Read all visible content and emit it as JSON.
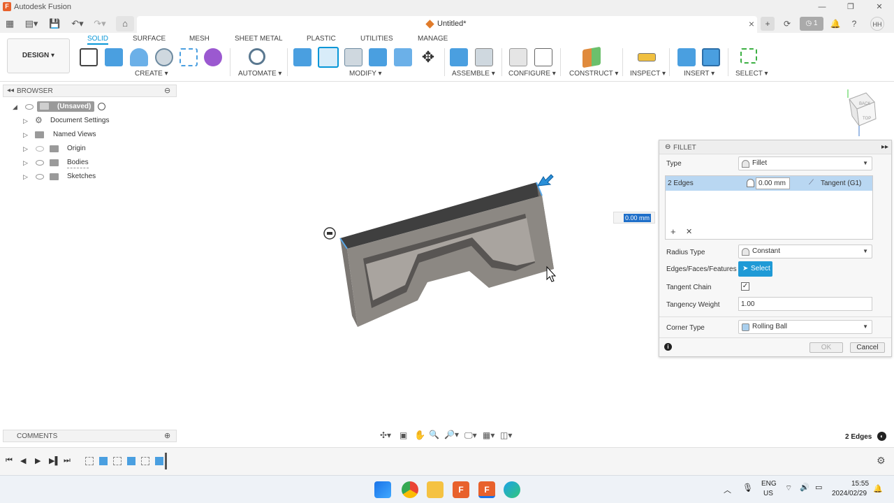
{
  "window": {
    "title": "Autodesk Fusion"
  },
  "document": {
    "title": "Untitled*"
  },
  "ribbon": {
    "tabs": [
      "SOLID",
      "SURFACE",
      "MESH",
      "SHEET METAL",
      "PLASTIC",
      "UTILITIES",
      "MANAGE"
    ],
    "design_label": "DESIGN ▾",
    "groups": [
      "CREATE ▾",
      "AUTOMATE ▾",
      "MODIFY ▾",
      "ASSEMBLE ▾",
      "CONFIGURE ▾",
      "CONSTRUCT ▾",
      "INSPECT ▾",
      "INSERT ▾",
      "SELECT ▾"
    ]
  },
  "browser": {
    "title": "BROWSER",
    "root": "(Unsaved)",
    "items": [
      "Document Settings",
      "Named Views",
      "Origin",
      "Bodies",
      "Sketches"
    ]
  },
  "comments": {
    "title": "COMMENTS"
  },
  "header": {
    "job_count": "1",
    "user": "HH"
  },
  "fillet": {
    "title": "FILLET",
    "type_label": "Type",
    "type_value": "Fillet",
    "selection": {
      "edges": "2 Edges",
      "radius": "0.00 mm",
      "continuity": "Tangent (G1)"
    },
    "radius_type_label": "Radius Type",
    "radius_type_value": "Constant",
    "edges_label": "Edges/Faces/Features",
    "select_button": "Select",
    "tangent_chain_label": "Tangent Chain",
    "tangent_chain_checked": true,
    "tangency_weight_label": "Tangency Weight",
    "tangency_weight_value": "1.00",
    "corner_type_label": "Corner Type",
    "corner_type_value": "Rolling Ball",
    "ok_label": "OK",
    "cancel_label": "Cancel"
  },
  "viewport": {
    "distance_input": "0.00 mm",
    "selection_status": "2 Edges",
    "viewcube": {
      "face_top": "TOP",
      "face_back": "BACK"
    }
  },
  "taskbar": {
    "lang_line1": "ENG",
    "lang_line2": "US",
    "time": "15:55",
    "date": "2024/02/29"
  },
  "colors": {
    "accent": "#0696d7",
    "select_button": "#1f9ad6",
    "selection_highlight": "#b9d7f2",
    "body_face": "#8c8883",
    "body_top": "#3f3f3f"
  }
}
